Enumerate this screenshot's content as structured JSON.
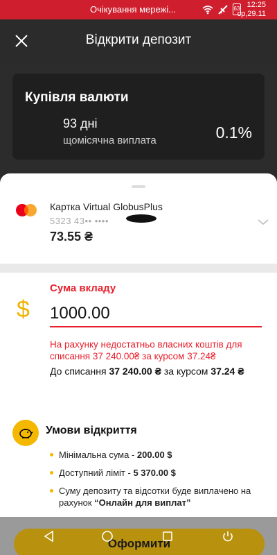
{
  "status_bar": {
    "network_text": "Очікування мережі...",
    "time": "12:25",
    "date": "ср,29.11",
    "battery": "63"
  },
  "header": {
    "title": "Відкрити депозит"
  },
  "deposit_card": {
    "title": "Купівля валюти",
    "icon": "dollar-icon",
    "term": "93 дні",
    "payout": "щомісячна виплата",
    "rate": "0.1%"
  },
  "payment_card": {
    "name": "Картка Virtual GlobusPlus",
    "number": "5323  43••  ••••",
    "balance": "73.55 ₴"
  },
  "amount": {
    "label": "Сума вкладу",
    "value": "1000.00",
    "warning": "На рахунку недостатньо власних коштів для списання 37 240.00₴ за курсом 37.24₴",
    "info_prefix": "До списання ",
    "info_amount": "37 240.00 ₴",
    "info_mid": " за курсом ",
    "info_rate": "37.24 ₴"
  },
  "conditions": {
    "title": "Умови відкриття",
    "items": [
      {
        "prefix": "Мінімальна сума - ",
        "value": "200.00 $",
        "suffix": ""
      },
      {
        "prefix": "Доступний ліміт - ",
        "value": "5 370.00 $",
        "suffix": ""
      },
      {
        "prefix": "Суму депозиту та відсотки буде виплачено на рахунок ",
        "value": "“Онлайн для виплат”",
        "suffix": ""
      }
    ]
  },
  "submit_label": "Оформити",
  "colors": {
    "status_red": "#cf1f2e",
    "accent_yellow": "#f5b800",
    "error_red": "#e8202d",
    "dark_bg": "#2b2b2b"
  }
}
